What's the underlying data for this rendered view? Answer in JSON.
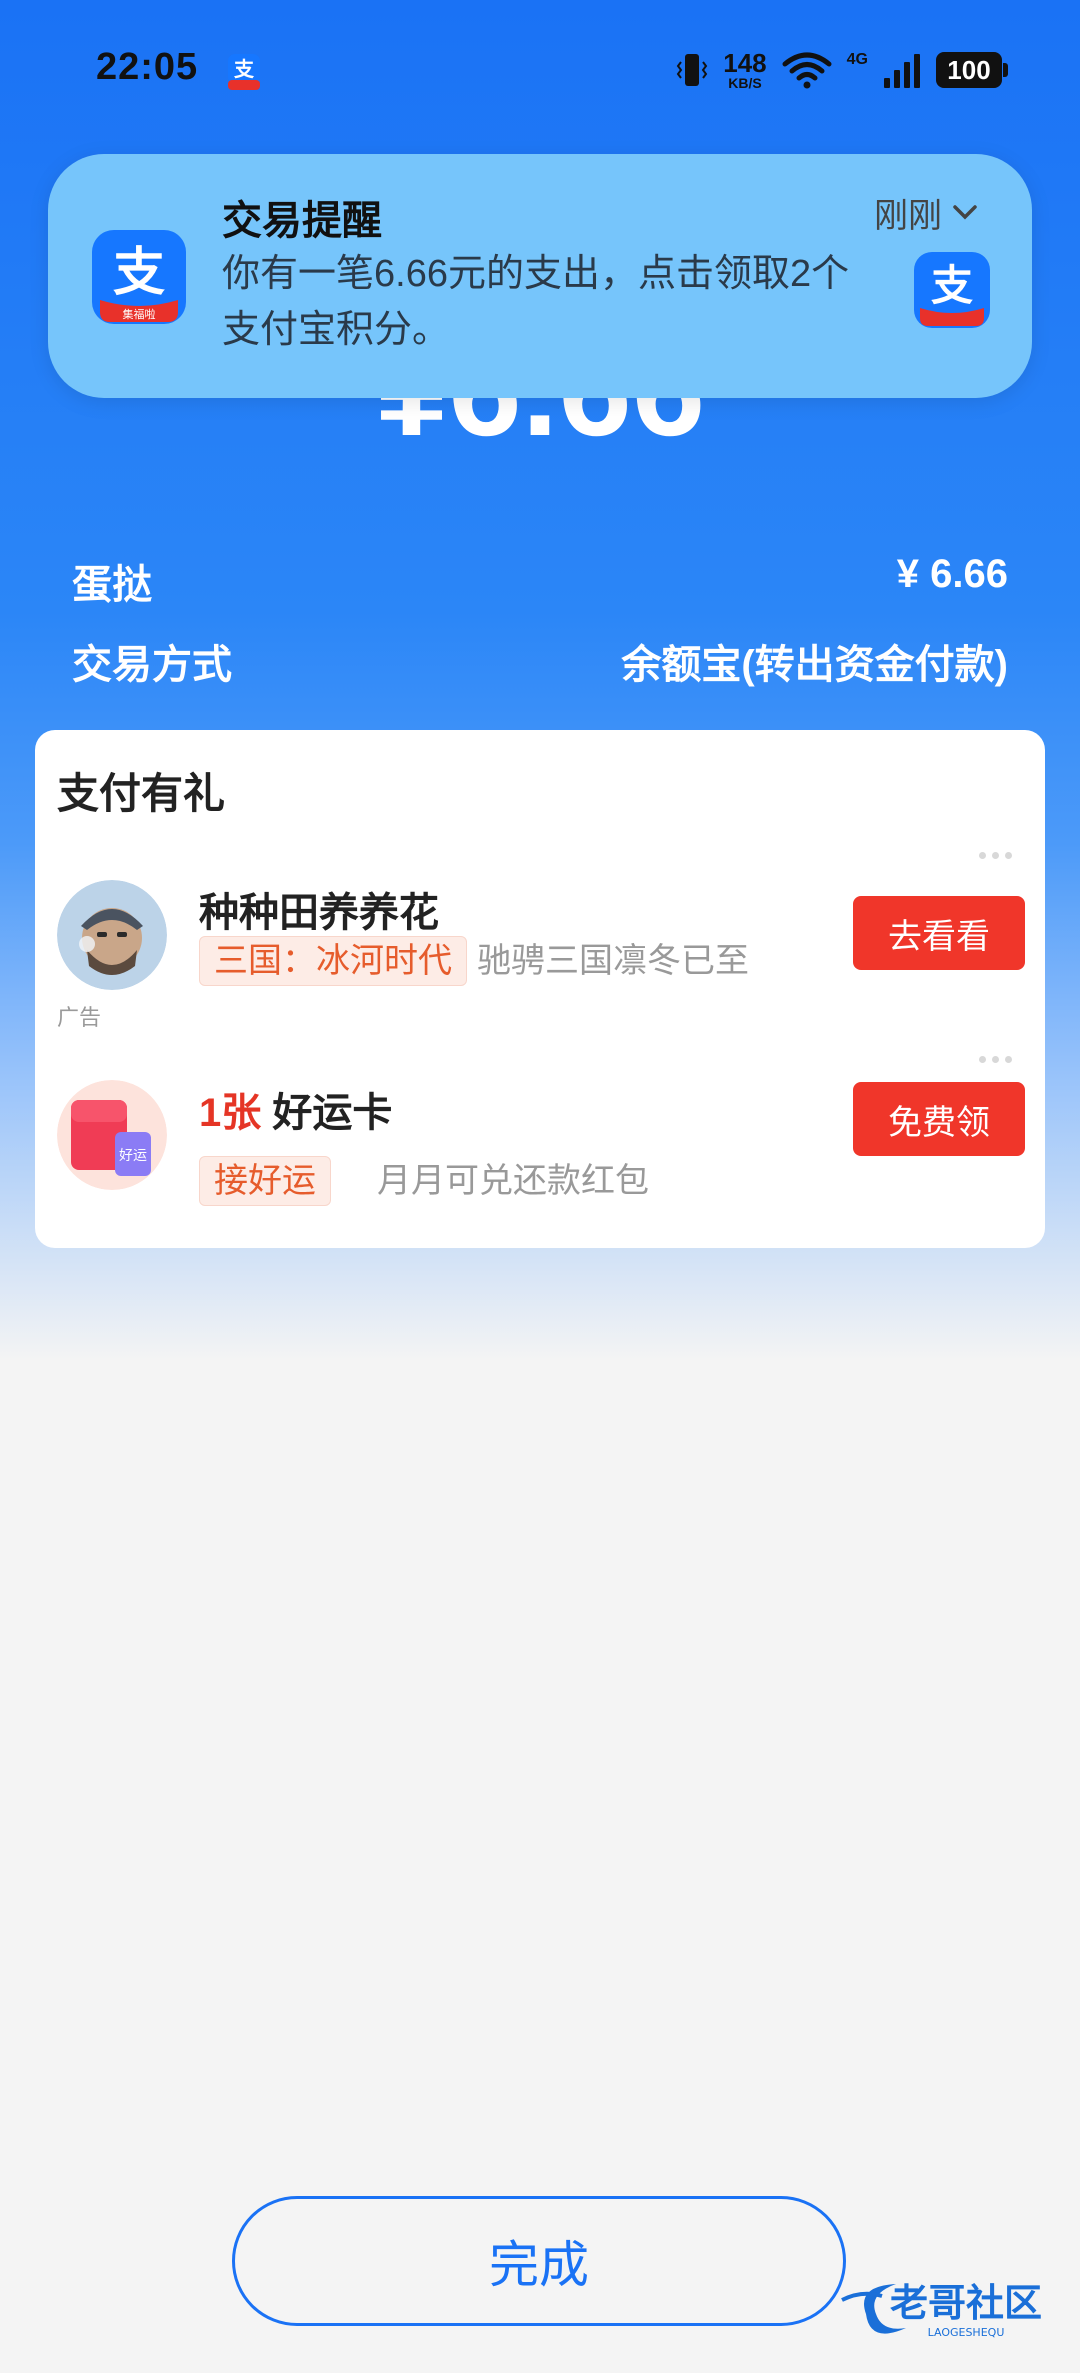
{
  "status_bar": {
    "time": "22:05",
    "net_speed": "148",
    "net_speed_unit": "KB/S",
    "network_type": "4G",
    "battery": "100"
  },
  "notification": {
    "title": "交易提醒",
    "time": "刚刚",
    "body": "你有一笔6.66元的支出，点击领取2个支付宝积分。",
    "icon": "alipay-icon",
    "icon_badge": "集福啦"
  },
  "payment": {
    "amount": "¥6.66"
  },
  "details": [
    {
      "label": "蛋挞",
      "value": "¥ 6.66"
    },
    {
      "label": "交易方式",
      "value": "余额宝(转出资金付款)"
    }
  ],
  "rewards": {
    "title": "支付有礼",
    "ad_label": "广告",
    "items": [
      {
        "title": "种种田养养花",
        "tag": "三国：冰河时代",
        "subtitle": "驰骋三国凛冬已至",
        "button": "去看看"
      },
      {
        "title_highlight": "1张",
        "title": " 好运卡",
        "tag": "接好运",
        "subtitle": "月月可兑还款红包",
        "button": "免费领"
      }
    ]
  },
  "done_button": "完成",
  "watermark": {
    "text": "老哥社区",
    "sub": "LAOGESHEQU"
  },
  "colors": {
    "brand_blue": "#1a72f5",
    "notification_bg": "#76c5fb",
    "action_red": "#f0362a",
    "tag_orange": "#e65c2c"
  }
}
